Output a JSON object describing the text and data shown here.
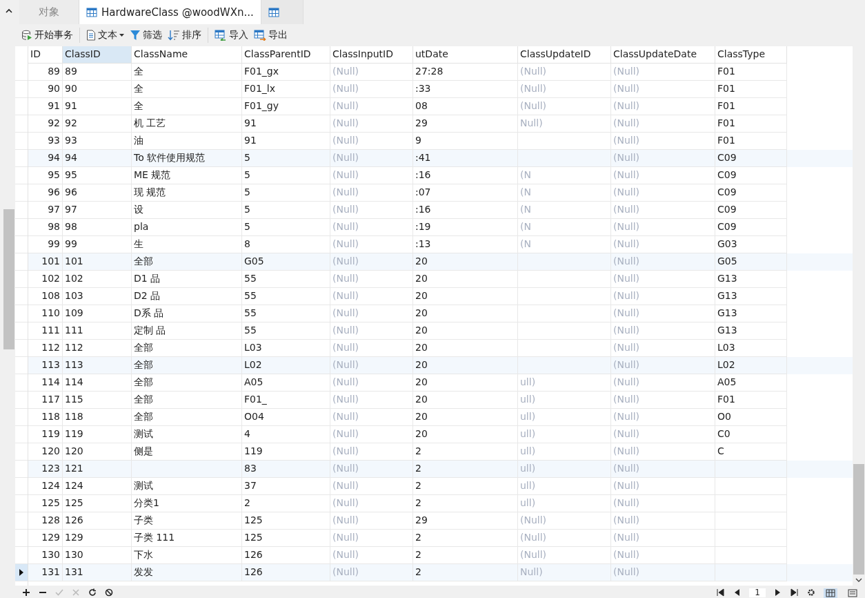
{
  "tabs": [
    {
      "label": "对象",
      "kind": "objects",
      "selected": false
    },
    {
      "label": "HardwareClass @woodWXn...",
      "kind": "table",
      "selected": true
    },
    {
      "kind": "table",
      "selected": false
    }
  ],
  "toolbar": [
    {
      "label": "开始事务",
      "kind": "db"
    },
    {
      "label": "文本",
      "kind": "doc",
      "dropdown": true,
      "divider_before": true
    },
    {
      "label": "筛选",
      "kind": "filter"
    },
    {
      "label": "排序",
      "kind": "sort"
    },
    {
      "label": "导入",
      "kind": "import",
      "divider_before": true
    },
    {
      "label": "导出",
      "kind": "export"
    }
  ],
  "table": {
    "columns": [
      {
        "label": "ID",
        "selected": false
      },
      {
        "label": "ClassID",
        "selected": true
      },
      {
        "label": "ClassName",
        "selected": false
      },
      {
        "label": "ClassParentID",
        "selected": false
      },
      {
        "label": "ClassInputID",
        "selected": false
      },
      {
        "label": "utDate",
        "selected": false
      },
      {
        "label": "ClassUpdateID",
        "selected": false
      },
      {
        "label": "ClassUpdateDate",
        "selected": false
      },
      {
        "label": "ClassType",
        "selected": false
      }
    ],
    "rows": [
      {
        "cells": [
          "89",
          "89",
          "全",
          "F01_gx",
          "(Null)",
          "27:28",
          "(Null)",
          "(Null)",
          "F01"
        ],
        "selected": false,
        "highlighted": false
      },
      {
        "cells": [
          "90",
          "90",
          "全",
          "F01_lx",
          "(Null)",
          ":33",
          "(Null)",
          "(Null)",
          "F01"
        ],
        "selected": false,
        "highlighted": false
      },
      {
        "cells": [
          "91",
          "91",
          "全",
          "F01_gy",
          "(Null)",
          "08",
          "(Null)",
          "(Null)",
          "F01"
        ],
        "selected": false,
        "highlighted": false
      },
      {
        "cells": [
          "92",
          "92",
          "机 工艺",
          "91",
          "(Null)",
          "29",
          "Null)",
          "(Null)",
          "F01"
        ],
        "selected": false,
        "highlighted": false
      },
      {
        "cells": [
          "93",
          "93",
          "油",
          "91",
          "(Null)",
          "9",
          null,
          "(Null)",
          "F01"
        ],
        "selected": false,
        "highlighted": false
      },
      {
        "cells": [
          "94",
          "94",
          "To 软件使用规范",
          "5",
          "(Null)",
          ":41",
          null,
          "(Null)",
          "C09"
        ],
        "selected": false,
        "highlighted": true
      },
      {
        "cells": [
          "95",
          "95",
          "ME 规范",
          "5",
          "(Null)",
          ":16",
          "(N",
          "(Null)",
          "C09"
        ],
        "selected": false,
        "highlighted": false
      },
      {
        "cells": [
          "96",
          "96",
          "现 规范",
          "5",
          "(Null)",
          ":07",
          "(N",
          "(Null)",
          "C09"
        ],
        "selected": false,
        "highlighted": false
      },
      {
        "cells": [
          "97",
          "97",
          "设",
          "5",
          "(Null)",
          ":16",
          "(N",
          "(Null)",
          "C09"
        ],
        "selected": false,
        "highlighted": false
      },
      {
        "cells": [
          "98",
          "98",
          "pla",
          "5",
          "(Null)",
          ":19",
          "(N",
          "(Null)",
          "C09"
        ],
        "selected": false,
        "highlighted": false
      },
      {
        "cells": [
          "99",
          "99",
          "生",
          "8",
          "(Null)",
          ":13",
          "(N",
          "(Null)",
          "G03"
        ],
        "selected": false,
        "highlighted": false
      },
      {
        "cells": [
          "101",
          "101",
          "全部",
          "G05",
          "(Null)",
          "20",
          null,
          "(Null)",
          "G05"
        ],
        "selected": false,
        "highlighted": true
      },
      {
        "cells": [
          "102",
          "102",
          "D1 品",
          "55",
          "(Null)",
          "20",
          null,
          "(Null)",
          "G13"
        ],
        "selected": false,
        "highlighted": false
      },
      {
        "cells": [
          "108",
          "103",
          "D2 品",
          "55",
          "(Null)",
          "20",
          null,
          "(Null)",
          "G13"
        ],
        "selected": false,
        "highlighted": false
      },
      {
        "cells": [
          "110",
          "109",
          "D系 品",
          "55",
          "(Null)",
          "20",
          null,
          "(Null)",
          "G13"
        ],
        "selected": false,
        "highlighted": false
      },
      {
        "cells": [
          "111",
          "111",
          "定制 品",
          "55",
          "(Null)",
          "20",
          null,
          "(Null)",
          "G13"
        ],
        "selected": false,
        "highlighted": false
      },
      {
        "cells": [
          "112",
          "112",
          "全部",
          "L03",
          "(Null)",
          "20",
          null,
          "(Null)",
          "L03"
        ],
        "selected": false,
        "highlighted": false
      },
      {
        "cells": [
          "113",
          "113",
          "全部",
          "L02",
          "(Null)",
          "20",
          null,
          "(Null)",
          "L02"
        ],
        "selected": false,
        "highlighted": true
      },
      {
        "cells": [
          "114",
          "114",
          "全部",
          "A05",
          "(Null)",
          "20",
          "ull)",
          "(Null)",
          "A05"
        ],
        "selected": false,
        "highlighted": false
      },
      {
        "cells": [
          "117",
          "115",
          "全部",
          "F01_",
          "(Null)",
          "20",
          "ull)",
          "(Null)",
          "F01"
        ],
        "selected": false,
        "highlighted": false
      },
      {
        "cells": [
          "118",
          "118",
          "全部",
          "O04",
          "(Null)",
          "20",
          "ull)",
          "(Null)",
          "O0"
        ],
        "selected": false,
        "highlighted": false
      },
      {
        "cells": [
          "119",
          "119",
          "测试",
          "4",
          "(Null)",
          "20",
          "ull)",
          "(Null)",
          "C0"
        ],
        "selected": false,
        "highlighted": false
      },
      {
        "cells": [
          "120",
          "120",
          "侧是",
          "119",
          "(Null)",
          "2",
          "ull)",
          "(Null)",
          "C"
        ],
        "selected": false,
        "highlighted": false
      },
      {
        "cells": [
          "123",
          "121",
          null,
          "83",
          "(Null)",
          "2",
          "ull)",
          "(Null)",
          null
        ],
        "selected": false,
        "highlighted": true
      },
      {
        "cells": [
          "124",
          "124",
          "测试",
          "37",
          "(Null)",
          "2",
          "ull)",
          "(Null)",
          null
        ],
        "selected": false,
        "highlighted": false
      },
      {
        "cells": [
          "125",
          "125",
          "分类1",
          "2",
          "(Null)",
          "2",
          "ull)",
          "(Null)",
          null
        ],
        "selected": false,
        "highlighted": false
      },
      {
        "cells": [
          "128",
          "126",
          "子类",
          "125",
          "(Null)",
          "29",
          "(Null)",
          "(Null)",
          null
        ],
        "selected": false,
        "highlighted": false
      },
      {
        "cells": [
          "129",
          "129",
          "子类 111",
          "125",
          "(Null)",
          "2",
          "(Null)",
          "(Null)",
          null
        ],
        "selected": false,
        "highlighted": false
      },
      {
        "cells": [
          "130",
          "130",
          "下水",
          "126",
          "(Null)",
          "2",
          "(Null)",
          "(Null)",
          null
        ],
        "selected": false,
        "highlighted": false
      },
      {
        "cells": [
          "131",
          "131",
          "发发",
          "126",
          "(Null)",
          "2",
          "Null)",
          "(Null)",
          null
        ],
        "selected": true,
        "highlighted": true
      }
    ]
  },
  "pager": {
    "page": "1"
  }
}
